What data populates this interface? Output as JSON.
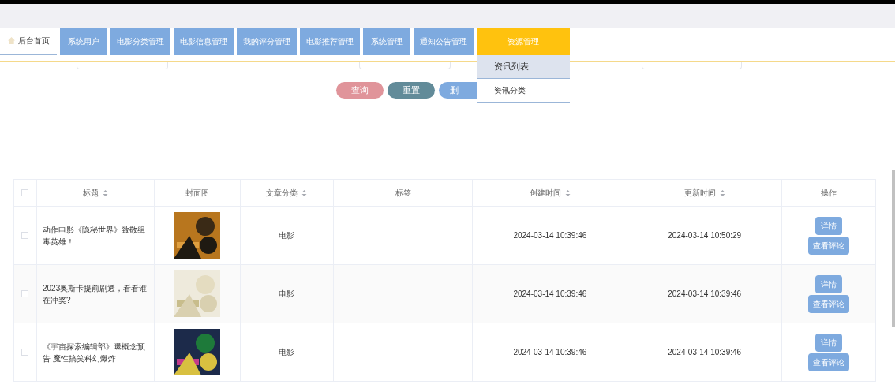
{
  "nav": {
    "home": "后台首页",
    "items": [
      {
        "label": "系统用户",
        "selected": false
      },
      {
        "label": "电影分类管理",
        "selected": false
      },
      {
        "label": "电影信息管理",
        "selected": false
      },
      {
        "label": "我的评分管理",
        "selected": false
      },
      {
        "label": "电影推荐管理",
        "selected": false
      },
      {
        "label": "系统管理",
        "selected": false
      },
      {
        "label": "通知公告管理",
        "selected": false
      },
      {
        "label": "资源管理",
        "selected": true
      }
    ],
    "dropdown": [
      {
        "label": "资讯列表",
        "selected": true
      },
      {
        "label": "资讯分类",
        "selected": false
      }
    ]
  },
  "actions": [
    "查询",
    "重置",
    "删"
  ],
  "table": {
    "select_all_checked": false,
    "columns": [
      {
        "label": "标题",
        "sortable": true
      },
      {
        "label": "封面图",
        "sortable": false
      },
      {
        "label": "文章分类",
        "sortable": true
      },
      {
        "label": "标签",
        "sortable": false
      },
      {
        "label": "创建时间",
        "sortable": true
      },
      {
        "label": "更新时间",
        "sortable": true
      },
      {
        "label": "操作",
        "sortable": false
      }
    ],
    "rows": [
      {
        "checked": false,
        "title": "动作电影《隐秘世界》致敬缉毒英雄！",
        "cover": {
          "kind": "picture"
        },
        "category": "电影",
        "created": "2024-03-14 10:39:46",
        "updated": "2024-03-14 10:50:29",
        "buttons": [
          "详情",
          "查看评论"
        ]
      },
      {
        "checked": false,
        "title": "2023奥斯卡提前剧透，看看谁在冲奖?",
        "cover": {
          "kind": "picture"
        },
        "category": "电影",
        "created": "2024-03-14 10:39:46",
        "updated": "2024-03-14 10:39:46",
        "buttons": [
          "详情",
          "查看评论"
        ]
      },
      {
        "checked": false,
        "title": "《宇宙探索编辑部》曝概念预告 魔性搞笑科幻爆炸",
        "cover": {
          "kind": "picture"
        },
        "category": "电影",
        "created": "2024-03-14 10:39:46",
        "updated": "2024-03-14 10:39:46",
        "buttons": [
          "详情",
          "查看评论"
        ]
      }
    ]
  }
}
